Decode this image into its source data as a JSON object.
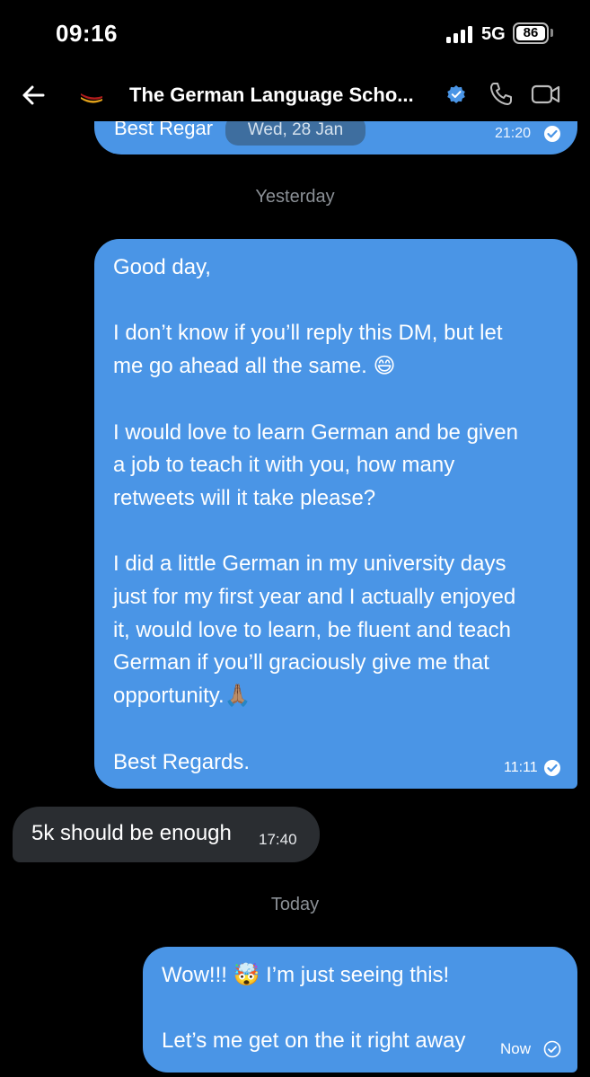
{
  "status_bar": {
    "time": "09:16",
    "network": "5G",
    "battery": "86"
  },
  "header": {
    "title": "The German Language Scho...",
    "accent": "#4a95e6"
  },
  "previous_message": {
    "text": "Best Regar",
    "time": "21:20"
  },
  "date_chip": "Wed, 28 Jan",
  "separators": {
    "yesterday": "Yesterday",
    "today": "Today"
  },
  "messages": [
    {
      "direction": "outgoing",
      "lines": [
        "Good day,",
        "",
        "I don’t know if you’ll reply this DM, but let",
        "me go ahead all the same. 😄",
        "",
        "I would love to learn German and be given",
        "a job to teach it with you, how many",
        "retweets will it take please?",
        "",
        "I did a little German in my university days",
        "just for my first year and I actually enjoyed",
        "it, would love to learn, be fluent and teach",
        "German if you’ll graciously give me that",
        "opportunity.🙏🏽",
        "",
        "Best Regards."
      ],
      "time": "11:11"
    },
    {
      "direction": "incoming",
      "text": "5k should be enough",
      "time": "17:40"
    },
    {
      "direction": "outgoing",
      "lines": [
        "Wow!!! 🤯 I’m just seeing this!",
        "",
        "Let’s me get on the it right away"
      ],
      "time": "Now"
    }
  ],
  "colors": {
    "outgoing_bubble": "#4a95e6",
    "incoming_bubble": "#2a2d31",
    "background": "#000000"
  }
}
